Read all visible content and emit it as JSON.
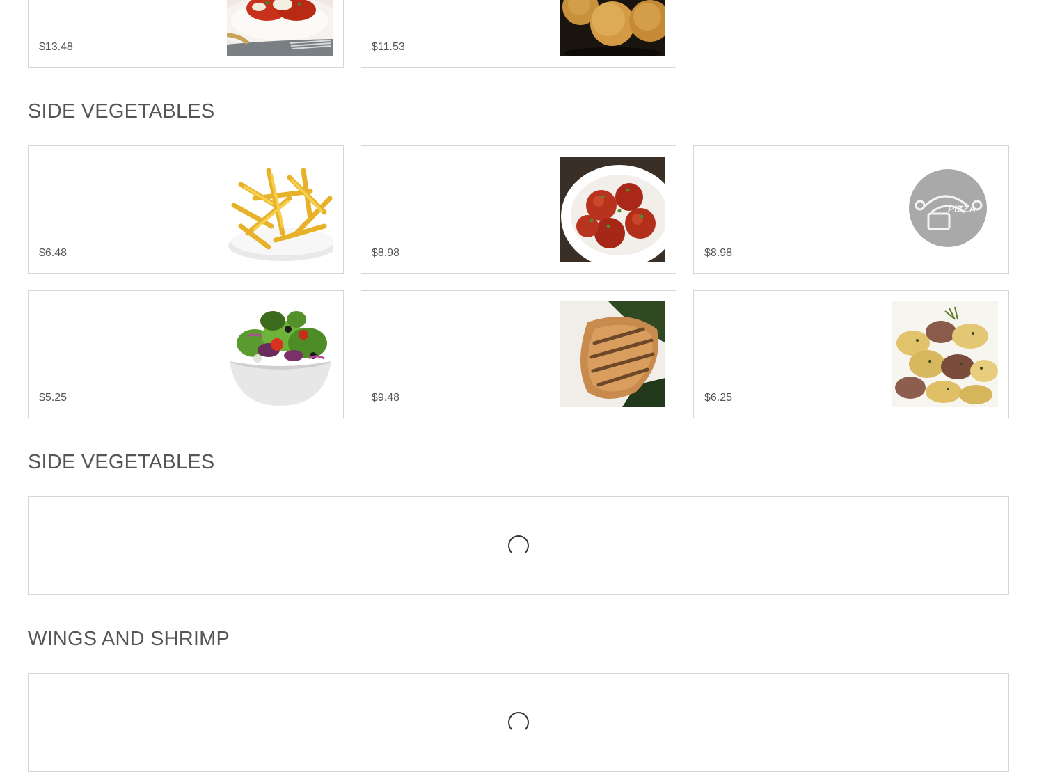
{
  "top_row": {
    "items": [
      {
        "price": "$13.48",
        "image": "stuffed-pasta-plate"
      },
      {
        "price": "$11.53",
        "image": "fried-rice-balls"
      }
    ]
  },
  "section_side_vegetables": {
    "title": "SIDE VEGETABLES",
    "items": [
      {
        "price": "$6.48",
        "image": "french-fries"
      },
      {
        "price": "$8.98",
        "image": "meatballs-bowl"
      },
      {
        "price": "$8.98",
        "image": "pizza-logo-placeholder"
      },
      {
        "price": "$5.25",
        "image": "garden-salad"
      },
      {
        "price": "$9.48",
        "image": "grilled-chicken"
      },
      {
        "price": "$6.25",
        "image": "roasted-potatoes"
      }
    ]
  },
  "section_side_vegetables_2": {
    "title": "SIDE VEGETABLES",
    "loading": true
  },
  "section_wings_shrimp": {
    "title": "WINGS AND SHRIMP",
    "loading": true
  },
  "colors": {
    "text": "#555555",
    "border": "#d6d6d6",
    "spinner": "#333333"
  }
}
